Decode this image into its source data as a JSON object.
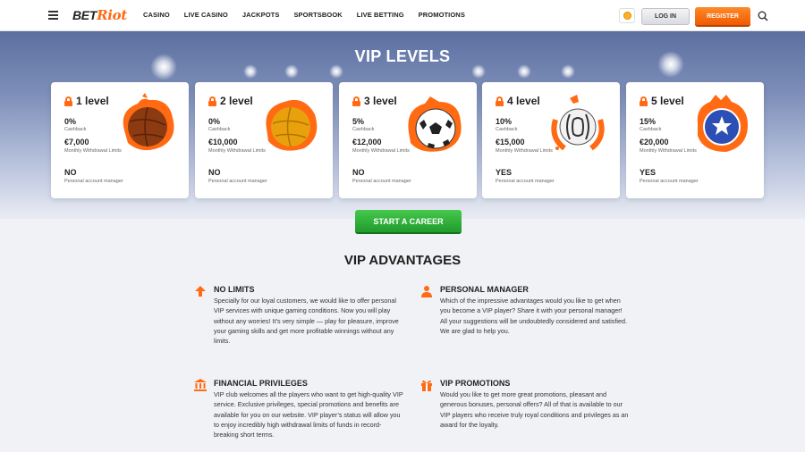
{
  "header": {
    "logo_part1": "BET",
    "logo_part2": "Riot",
    "nav": [
      "CASINO",
      "LIVE CASINO",
      "JACKPOTS",
      "SPORTSBOOK",
      "LIVE BETTING",
      "PROMOTIONS"
    ],
    "login_label": "LOG IN",
    "register_label": "REGISTER"
  },
  "hero": {
    "title": "VIP LEVELS"
  },
  "levels": [
    {
      "level": "1 level",
      "cashback": "0%",
      "cashback_label": "Cashback",
      "withdrawal": "€7,000",
      "withdrawal_label": "Monthly Withdrawal Limits",
      "manager": "NO",
      "manager_label": "Personal account manager",
      "ball_color": "#8b3a12"
    },
    {
      "level": "2 level",
      "cashback": "0%",
      "cashback_label": "Cashback",
      "withdrawal": "€10,000",
      "withdrawal_label": "Monthly Withdrawal Limits",
      "manager": "NO",
      "manager_label": "Personal account manager",
      "ball_color": "#e8a10d"
    },
    {
      "level": "3 level",
      "cashback": "5%",
      "cashback_label": "Cashback",
      "withdrawal": "€12,000",
      "withdrawal_label": "Monthly Withdrawal Limits",
      "manager": "NO",
      "manager_label": "Personal account manager",
      "ball_color": "#ffffff"
    },
    {
      "level": "4 level",
      "cashback": "10%",
      "cashback_label": "Cashback",
      "withdrawal": "€15,000",
      "withdrawal_label": "Monthly Withdrawal Limits",
      "manager": "YES",
      "manager_label": "Personal account manager",
      "ball_color": "#f2f2f2"
    },
    {
      "level": "5 level",
      "cashback": "15%",
      "cashback_label": "Cashback",
      "withdrawal": "€20,000",
      "withdrawal_label": "Monthly Withdrawal Limits",
      "manager": "YES",
      "manager_label": "Personal account manager",
      "ball_color": "#2b4fb5"
    }
  ],
  "cta_label": "START A CAREER",
  "advantages": {
    "title": "VIP ADVANTAGES",
    "items": [
      {
        "title": "NO LIMITS",
        "icon": "arrow-up-icon",
        "text": "Specially for our loyal customers, we would like to offer personal VIP services with unique gaming conditions. Now you will play without any worries! It’s very simple — play for pleasure, improve your gaming skills and get more profitable winnings without any limits."
      },
      {
        "title": "PERSONAL MANAGER",
        "icon": "person-icon",
        "text": "Which of the impressive advantages would you like to get when you become a VIP player? Share it with your personal manager! All your suggestions will be undoubtedly considered and satisfied. We are glad to help you."
      },
      {
        "title": "FINANCIAL PRIVILEGES",
        "icon": "bank-icon",
        "text": "VIP club welcomes all the players who want to get high-quality VIP service. Exclusive privileges, special promotions and benefits are available for you on our website. VIP player’s status will allow you to enjoy incredibly high withdrawal limits of funds in record-breaking short terms."
      },
      {
        "title": "VIP PROMOTIONS",
        "icon": "gift-icon",
        "text": "Would you like to get more great promotions, pleasant and generous bonuses, personal offers? All of that is available to our VIP players who receive truly royal conditions and privileges as an award for the loyalty."
      }
    ]
  },
  "colors": {
    "accent": "#ff6a13",
    "cta": "#2fb23a"
  }
}
